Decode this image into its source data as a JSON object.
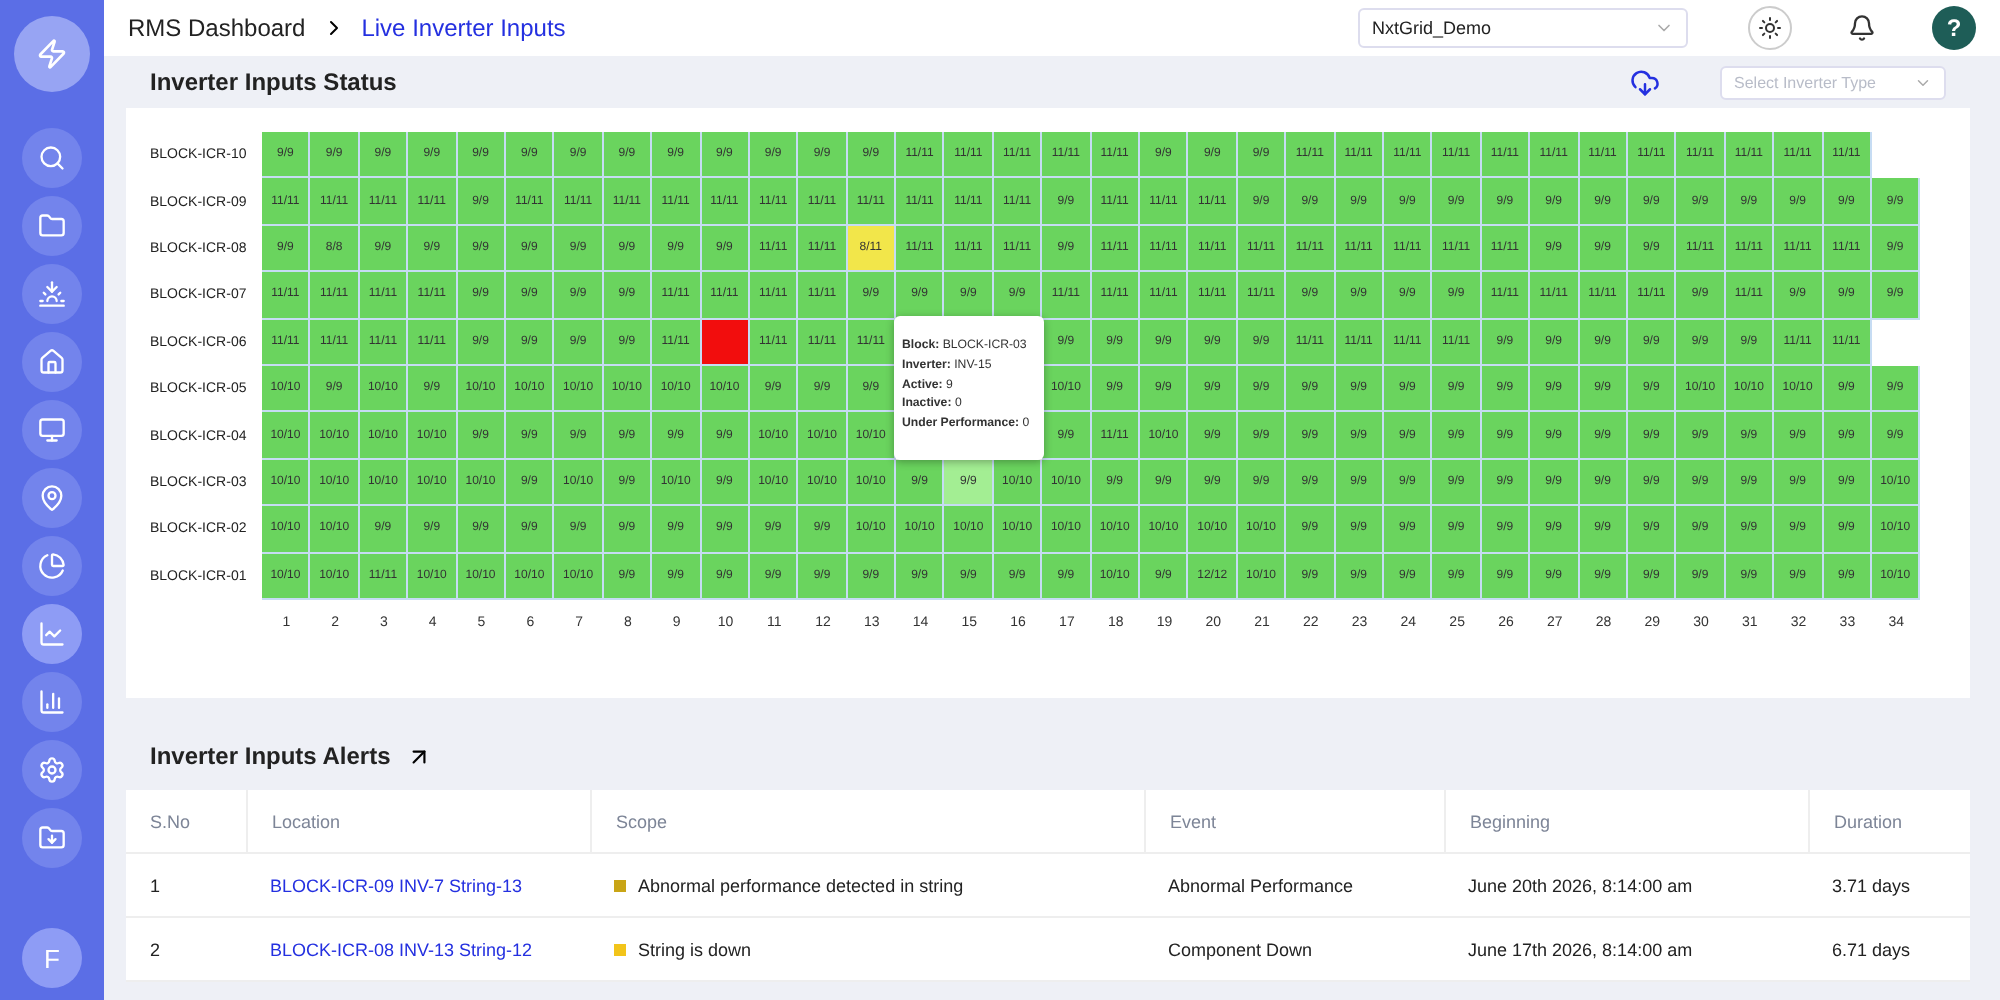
{
  "sidebar": {
    "items": [
      {
        "kind": "search",
        "selected": false
      },
      {
        "kind": "folder",
        "selected": false
      },
      {
        "kind": "sunset",
        "selected": false
      },
      {
        "kind": "home",
        "selected": false
      },
      {
        "kind": "monitor",
        "selected": false
      },
      {
        "kind": "location",
        "selected": false
      },
      {
        "kind": "pie",
        "selected": false
      },
      {
        "kind": "line",
        "selected": true
      },
      {
        "kind": "bar",
        "selected": false
      },
      {
        "kind": "settings",
        "selected": false
      },
      {
        "kind": "download",
        "selected": false
      }
    ],
    "avatar": "F"
  },
  "breadcrumb": [
    "RMS Dashboard",
    "Live Inverter Inputs"
  ],
  "site_select": {
    "value": "NxtGrid_Demo"
  },
  "help": "?",
  "status_panel": {
    "title": "Inverter Inputs Status",
    "type_select": {
      "placeholder": "Select Inverter Type"
    },
    "rows": [
      {
        "label": "BLOCK-ICR-10",
        "cells": [
          {
            "text": "9/9",
            "color": "#6ad45e"
          },
          {
            "text": "9/9",
            "color": "#6ad45e"
          },
          {
            "text": "9/9",
            "color": "#6ad45e"
          },
          {
            "text": "9/9",
            "color": "#6ad45e"
          },
          {
            "text": "9/9",
            "color": "#6ad45e"
          },
          {
            "text": "9/9",
            "color": "#6ad45e"
          },
          {
            "text": "9/9",
            "color": "#6ad45e"
          },
          {
            "text": "9/9",
            "color": "#6ad45e"
          },
          {
            "text": "9/9",
            "color": "#6ad45e"
          },
          {
            "text": "9/9",
            "color": "#6ad45e"
          },
          {
            "text": "9/9",
            "color": "#6ad45e"
          },
          {
            "text": "9/9",
            "color": "#6ad45e"
          },
          {
            "text": "9/9",
            "color": "#6ad45e"
          },
          {
            "text": "11/11",
            "color": "#6ad45e"
          },
          {
            "text": "11/11",
            "color": "#6ad45e"
          },
          {
            "text": "11/11",
            "color": "#6ad45e"
          },
          {
            "text": "11/11",
            "color": "#6ad45e"
          },
          {
            "text": "11/11",
            "color": "#6ad45e"
          },
          {
            "text": "9/9",
            "color": "#6ad45e"
          },
          {
            "text": "9/9",
            "color": "#6ad45e"
          },
          {
            "text": "9/9",
            "color": "#6ad45e"
          },
          {
            "text": "11/11",
            "color": "#6ad45e"
          },
          {
            "text": "11/11",
            "color": "#6ad45e"
          },
          {
            "text": "11/11",
            "color": "#6ad45e"
          },
          {
            "text": "11/11",
            "color": "#6ad45e"
          },
          {
            "text": "11/11",
            "color": "#6ad45e"
          },
          {
            "text": "11/11",
            "color": "#6ad45e"
          },
          {
            "text": "11/11",
            "color": "#6ad45e"
          },
          {
            "text": "11/11",
            "color": "#6ad45e"
          },
          {
            "text": "11/11",
            "color": "#6ad45e"
          },
          {
            "text": "11/11",
            "color": "#6ad45e"
          },
          {
            "text": "11/11",
            "color": "#6ad45e"
          },
          {
            "text": "11/11",
            "color": "#6ad45e"
          }
        ]
      },
      {
        "label": "BLOCK-ICR-09",
        "cells": [
          {
            "text": "11/11",
            "color": "#6ad45e"
          },
          {
            "text": "11/11",
            "color": "#6ad45e"
          },
          {
            "text": "11/11",
            "color": "#6ad45e"
          },
          {
            "text": "11/11",
            "color": "#6ad45e"
          },
          {
            "text": "9/9",
            "color": "#6ad45e"
          },
          {
            "text": "11/11",
            "color": "#6ad45e"
          },
          {
            "text": "11/11",
            "color": "#6ad45e"
          },
          {
            "text": "11/11",
            "color": "#6ad45e"
          },
          {
            "text": "11/11",
            "color": "#6ad45e"
          },
          {
            "text": "11/11",
            "color": "#6ad45e"
          },
          {
            "text": "11/11",
            "color": "#6ad45e"
          },
          {
            "text": "11/11",
            "color": "#6ad45e"
          },
          {
            "text": "11/11",
            "color": "#6ad45e"
          },
          {
            "text": "11/11",
            "color": "#6ad45e"
          },
          {
            "text": "11/11",
            "color": "#6ad45e"
          },
          {
            "text": "11/11",
            "color": "#6ad45e"
          },
          {
            "text": "9/9",
            "color": "#6ad45e"
          },
          {
            "text": "11/11",
            "color": "#6ad45e"
          },
          {
            "text": "11/11",
            "color": "#6ad45e"
          },
          {
            "text": "11/11",
            "color": "#6ad45e"
          },
          {
            "text": "9/9",
            "color": "#6ad45e"
          },
          {
            "text": "9/9",
            "color": "#6ad45e"
          },
          {
            "text": "9/9",
            "color": "#6ad45e"
          },
          {
            "text": "9/9",
            "color": "#6ad45e"
          },
          {
            "text": "9/9",
            "color": "#6ad45e"
          },
          {
            "text": "9/9",
            "color": "#6ad45e"
          },
          {
            "text": "9/9",
            "color": "#6ad45e"
          },
          {
            "text": "9/9",
            "color": "#6ad45e"
          },
          {
            "text": "9/9",
            "color": "#6ad45e"
          },
          {
            "text": "9/9",
            "color": "#6ad45e"
          },
          {
            "text": "9/9",
            "color": "#6ad45e"
          },
          {
            "text": "9/9",
            "color": "#6ad45e"
          },
          {
            "text": "9/9",
            "color": "#6ad45e"
          },
          {
            "text": "9/9",
            "color": "#6ad45e"
          }
        ]
      },
      {
        "label": "BLOCK-ICR-08",
        "cells": [
          {
            "text": "9/9",
            "color": "#6ad45e"
          },
          {
            "text": "8/8",
            "color": "#6ad45e"
          },
          {
            "text": "9/9",
            "color": "#6ad45e"
          },
          {
            "text": "9/9",
            "color": "#6ad45e"
          },
          {
            "text": "9/9",
            "color": "#6ad45e"
          },
          {
            "text": "9/9",
            "color": "#6ad45e"
          },
          {
            "text": "9/9",
            "color": "#6ad45e"
          },
          {
            "text": "9/9",
            "color": "#6ad45e"
          },
          {
            "text": "9/9",
            "color": "#6ad45e"
          },
          {
            "text": "9/9",
            "color": "#6ad45e"
          },
          {
            "text": "11/11",
            "color": "#6ad45e"
          },
          {
            "text": "11/11",
            "color": "#6ad45e"
          },
          {
            "text": "8/11",
            "color": "#f2e64a"
          },
          {
            "text": "11/11",
            "color": "#6ad45e"
          },
          {
            "text": "11/11",
            "color": "#6ad45e"
          },
          {
            "text": "11/11",
            "color": "#6ad45e"
          },
          {
            "text": "9/9",
            "color": "#6ad45e"
          },
          {
            "text": "11/11",
            "color": "#6ad45e"
          },
          {
            "text": "11/11",
            "color": "#6ad45e"
          },
          {
            "text": "11/11",
            "color": "#6ad45e"
          },
          {
            "text": "11/11",
            "color": "#6ad45e"
          },
          {
            "text": "11/11",
            "color": "#6ad45e"
          },
          {
            "text": "11/11",
            "color": "#6ad45e"
          },
          {
            "text": "11/11",
            "color": "#6ad45e"
          },
          {
            "text": "11/11",
            "color": "#6ad45e"
          },
          {
            "text": "11/11",
            "color": "#6ad45e"
          },
          {
            "text": "9/9",
            "color": "#6ad45e"
          },
          {
            "text": "9/9",
            "color": "#6ad45e"
          },
          {
            "text": "9/9",
            "color": "#6ad45e"
          },
          {
            "text": "11/11",
            "color": "#6ad45e"
          },
          {
            "text": "11/11",
            "color": "#6ad45e"
          },
          {
            "text": "11/11",
            "color": "#6ad45e"
          },
          {
            "text": "11/11",
            "color": "#6ad45e"
          },
          {
            "text": "9/9",
            "color": "#6ad45e"
          }
        ]
      },
      {
        "label": "BLOCK-ICR-07",
        "cells": [
          {
            "text": "11/11",
            "color": "#6ad45e"
          },
          {
            "text": "11/11",
            "color": "#6ad45e"
          },
          {
            "text": "11/11",
            "color": "#6ad45e"
          },
          {
            "text": "11/11",
            "color": "#6ad45e"
          },
          {
            "text": "9/9",
            "color": "#6ad45e"
          },
          {
            "text": "9/9",
            "color": "#6ad45e"
          },
          {
            "text": "9/9",
            "color": "#6ad45e"
          },
          {
            "text": "9/9",
            "color": "#6ad45e"
          },
          {
            "text": "11/11",
            "color": "#6ad45e"
          },
          {
            "text": "11/11",
            "color": "#6ad45e"
          },
          {
            "text": "11/11",
            "color": "#6ad45e"
          },
          {
            "text": "11/11",
            "color": "#6ad45e"
          },
          {
            "text": "9/9",
            "color": "#6ad45e"
          },
          {
            "text": "9/9",
            "color": "#6ad45e"
          },
          {
            "text": "9/9",
            "color": "#6ad45e"
          },
          {
            "text": "9/9",
            "color": "#6ad45e"
          },
          {
            "text": "11/11",
            "color": "#6ad45e"
          },
          {
            "text": "11/11",
            "color": "#6ad45e"
          },
          {
            "text": "11/11",
            "color": "#6ad45e"
          },
          {
            "text": "11/11",
            "color": "#6ad45e"
          },
          {
            "text": "11/11",
            "color": "#6ad45e"
          },
          {
            "text": "9/9",
            "color": "#6ad45e"
          },
          {
            "text": "9/9",
            "color": "#6ad45e"
          },
          {
            "text": "9/9",
            "color": "#6ad45e"
          },
          {
            "text": "9/9",
            "color": "#6ad45e"
          },
          {
            "text": "11/11",
            "color": "#6ad45e"
          },
          {
            "text": "11/11",
            "color": "#6ad45e"
          },
          {
            "text": "11/11",
            "color": "#6ad45e"
          },
          {
            "text": "11/11",
            "color": "#6ad45e"
          },
          {
            "text": "9/9",
            "color": "#6ad45e"
          },
          {
            "text": "11/11",
            "color": "#6ad45e"
          },
          {
            "text": "9/9",
            "color": "#6ad45e"
          },
          {
            "text": "9/9",
            "color": "#6ad45e"
          },
          {
            "text": "9/9",
            "color": "#6ad45e"
          }
        ]
      },
      {
        "label": "BLOCK-ICR-06",
        "cells": [
          {
            "text": "11/11",
            "color": "#6ad45e"
          },
          {
            "text": "11/11",
            "color": "#6ad45e"
          },
          {
            "text": "11/11",
            "color": "#6ad45e"
          },
          {
            "text": "11/11",
            "color": "#6ad45e"
          },
          {
            "text": "9/9",
            "color": "#6ad45e"
          },
          {
            "text": "9/9",
            "color": "#6ad45e"
          },
          {
            "text": "9/9",
            "color": "#6ad45e"
          },
          {
            "text": "9/9",
            "color": "#6ad45e"
          },
          {
            "text": "11/11",
            "color": "#6ad45e"
          },
          {
            "color": "#f20d0d"
          },
          {
            "text": "11/11",
            "color": "#6ad45e"
          },
          {
            "text": "11/11",
            "color": "#6ad45e"
          },
          {
            "text": "11/11",
            "color": "#6ad45e"
          },
          null,
          null,
          null,
          {
            "text": "9/9",
            "color": "#6ad45e"
          },
          {
            "text": "9/9",
            "color": "#6ad45e"
          },
          {
            "text": "9/9",
            "color": "#6ad45e"
          },
          {
            "text": "9/9",
            "color": "#6ad45e"
          },
          {
            "text": "9/9",
            "color": "#6ad45e"
          },
          {
            "text": "11/11",
            "color": "#6ad45e"
          },
          {
            "text": "11/11",
            "color": "#6ad45e"
          },
          {
            "text": "11/11",
            "color": "#6ad45e"
          },
          {
            "text": "11/11",
            "color": "#6ad45e"
          },
          {
            "text": "9/9",
            "color": "#6ad45e"
          },
          {
            "text": "9/9",
            "color": "#6ad45e"
          },
          {
            "text": "9/9",
            "color": "#6ad45e"
          },
          {
            "text": "9/9",
            "color": "#6ad45e"
          },
          {
            "text": "9/9",
            "color": "#6ad45e"
          },
          {
            "text": "9/9",
            "color": "#6ad45e"
          },
          {
            "text": "11/11",
            "color": "#6ad45e"
          },
          {
            "text": "11/11",
            "color": "#6ad45e"
          }
        ]
      },
      {
        "label": "BLOCK-ICR-05",
        "cells": [
          {
            "text": "10/10",
            "color": "#6ad45e"
          },
          {
            "text": "9/9",
            "color": "#6ad45e"
          },
          {
            "text": "10/10",
            "color": "#6ad45e"
          },
          {
            "text": "9/9",
            "color": "#6ad45e"
          },
          {
            "text": "10/10",
            "color": "#6ad45e"
          },
          {
            "text": "10/10",
            "color": "#6ad45e"
          },
          {
            "text": "10/10",
            "color": "#6ad45e"
          },
          {
            "text": "10/10",
            "color": "#6ad45e"
          },
          {
            "text": "10/10",
            "color": "#6ad45e"
          },
          {
            "text": "10/10",
            "color": "#6ad45e"
          },
          {
            "text": "9/9",
            "color": "#6ad45e"
          },
          {
            "text": "9/9",
            "color": "#6ad45e"
          },
          {
            "text": "9/9",
            "color": "#6ad45e"
          },
          null,
          null,
          null,
          {
            "text": "10/10",
            "color": "#6ad45e"
          },
          {
            "text": "9/9",
            "color": "#6ad45e"
          },
          {
            "text": "9/9",
            "color": "#6ad45e"
          },
          {
            "text": "9/9",
            "color": "#6ad45e"
          },
          {
            "text": "9/9",
            "color": "#6ad45e"
          },
          {
            "text": "9/9",
            "color": "#6ad45e"
          },
          {
            "text": "9/9",
            "color": "#6ad45e"
          },
          {
            "text": "9/9",
            "color": "#6ad45e"
          },
          {
            "text": "9/9",
            "color": "#6ad45e"
          },
          {
            "text": "9/9",
            "color": "#6ad45e"
          },
          {
            "text": "9/9",
            "color": "#6ad45e"
          },
          {
            "text": "9/9",
            "color": "#6ad45e"
          },
          {
            "text": "9/9",
            "color": "#6ad45e"
          },
          {
            "text": "10/10",
            "color": "#6ad45e"
          },
          {
            "text": "10/10",
            "color": "#6ad45e"
          },
          {
            "text": "10/10",
            "color": "#6ad45e"
          },
          {
            "text": "9/9",
            "color": "#6ad45e"
          },
          {
            "text": "9/9",
            "color": "#6ad45e"
          }
        ]
      },
      {
        "label": "BLOCK-ICR-04",
        "cells": [
          {
            "text": "10/10",
            "color": "#6ad45e"
          },
          {
            "text": "10/10",
            "color": "#6ad45e"
          },
          {
            "text": "10/10",
            "color": "#6ad45e"
          },
          {
            "text": "10/10",
            "color": "#6ad45e"
          },
          {
            "text": "9/9",
            "color": "#6ad45e"
          },
          {
            "text": "9/9",
            "color": "#6ad45e"
          },
          {
            "text": "9/9",
            "color": "#6ad45e"
          },
          {
            "text": "9/9",
            "color": "#6ad45e"
          },
          {
            "text": "9/9",
            "color": "#6ad45e"
          },
          {
            "text": "9/9",
            "color": "#6ad45e"
          },
          {
            "text": "10/10",
            "color": "#6ad45e"
          },
          {
            "text": "10/10",
            "color": "#6ad45e"
          },
          {
            "text": "10/10",
            "color": "#6ad45e"
          },
          null,
          null,
          null,
          {
            "text": "9/9",
            "color": "#6ad45e"
          },
          {
            "text": "11/11",
            "color": "#6ad45e"
          },
          {
            "text": "10/10",
            "color": "#6ad45e"
          },
          {
            "text": "9/9",
            "color": "#6ad45e"
          },
          {
            "text": "9/9",
            "color": "#6ad45e"
          },
          {
            "text": "9/9",
            "color": "#6ad45e"
          },
          {
            "text": "9/9",
            "color": "#6ad45e"
          },
          {
            "text": "9/9",
            "color": "#6ad45e"
          },
          {
            "text": "9/9",
            "color": "#6ad45e"
          },
          {
            "text": "9/9",
            "color": "#6ad45e"
          },
          {
            "text": "9/9",
            "color": "#6ad45e"
          },
          {
            "text": "9/9",
            "color": "#6ad45e"
          },
          {
            "text": "9/9",
            "color": "#6ad45e"
          },
          {
            "text": "9/9",
            "color": "#6ad45e"
          },
          {
            "text": "9/9",
            "color": "#6ad45e"
          },
          {
            "text": "9/9",
            "color": "#6ad45e"
          },
          {
            "text": "9/9",
            "color": "#6ad45e"
          },
          {
            "text": "9/9",
            "color": "#6ad45e"
          }
        ]
      },
      {
        "label": "BLOCK-ICR-03",
        "cells": [
          {
            "text": "10/10",
            "color": "#6ad45e"
          },
          {
            "text": "10/10",
            "color": "#6ad45e"
          },
          {
            "text": "10/10",
            "color": "#6ad45e"
          },
          {
            "text": "10/10",
            "color": "#6ad45e"
          },
          {
            "text": "10/10",
            "color": "#6ad45e"
          },
          {
            "text": "9/9",
            "color": "#6ad45e"
          },
          {
            "text": "10/10",
            "color": "#6ad45e"
          },
          {
            "text": "9/9",
            "color": "#6ad45e"
          },
          {
            "text": "10/10",
            "color": "#6ad45e"
          },
          {
            "text": "9/9",
            "color": "#6ad45e"
          },
          {
            "text": "10/10",
            "color": "#6ad45e"
          },
          {
            "text": "10/10",
            "color": "#6ad45e"
          },
          {
            "text": "10/10",
            "color": "#6ad45e"
          },
          {
            "text": "9/9",
            "color": "#6ad45e"
          },
          {
            "text": "9/9",
            "color": "#a3ee93"
          },
          {
            "text": "10/10",
            "color": "#6ad45e"
          },
          {
            "text": "10/10",
            "color": "#6ad45e"
          },
          {
            "text": "9/9",
            "color": "#6ad45e"
          },
          {
            "text": "9/9",
            "color": "#6ad45e"
          },
          {
            "text": "9/9",
            "color": "#6ad45e"
          },
          {
            "text": "9/9",
            "color": "#6ad45e"
          },
          {
            "text": "9/9",
            "color": "#6ad45e"
          },
          {
            "text": "9/9",
            "color": "#6ad45e"
          },
          {
            "text": "9/9",
            "color": "#6ad45e"
          },
          {
            "text": "9/9",
            "color": "#6ad45e"
          },
          {
            "text": "9/9",
            "color": "#6ad45e"
          },
          {
            "text": "9/9",
            "color": "#6ad45e"
          },
          {
            "text": "9/9",
            "color": "#6ad45e"
          },
          {
            "text": "9/9",
            "color": "#6ad45e"
          },
          {
            "text": "9/9",
            "color": "#6ad45e"
          },
          {
            "text": "9/9",
            "color": "#6ad45e"
          },
          {
            "text": "9/9",
            "color": "#6ad45e"
          },
          {
            "text": "9/9",
            "color": "#6ad45e"
          },
          {
            "text": "10/10",
            "color": "#6ad45e"
          }
        ]
      },
      {
        "label": "BLOCK-ICR-02",
        "cells": [
          {
            "text": "10/10",
            "color": "#6ad45e"
          },
          {
            "text": "10/10",
            "color": "#6ad45e"
          },
          {
            "text": "9/9",
            "color": "#6ad45e"
          },
          {
            "text": "9/9",
            "color": "#6ad45e"
          },
          {
            "text": "9/9",
            "color": "#6ad45e"
          },
          {
            "text": "9/9",
            "color": "#6ad45e"
          },
          {
            "text": "9/9",
            "color": "#6ad45e"
          },
          {
            "text": "9/9",
            "color": "#6ad45e"
          },
          {
            "text": "9/9",
            "color": "#6ad45e"
          },
          {
            "text": "9/9",
            "color": "#6ad45e"
          },
          {
            "text": "9/9",
            "color": "#6ad45e"
          },
          {
            "text": "9/9",
            "color": "#6ad45e"
          },
          {
            "text": "10/10",
            "color": "#6ad45e"
          },
          {
            "text": "10/10",
            "color": "#6ad45e"
          },
          {
            "text": "10/10",
            "color": "#6ad45e"
          },
          {
            "text": "10/10",
            "color": "#6ad45e"
          },
          {
            "text": "10/10",
            "color": "#6ad45e"
          },
          {
            "text": "10/10",
            "color": "#6ad45e"
          },
          {
            "text": "10/10",
            "color": "#6ad45e"
          },
          {
            "text": "10/10",
            "color": "#6ad45e"
          },
          {
            "text": "10/10",
            "color": "#6ad45e"
          },
          {
            "text": "9/9",
            "color": "#6ad45e"
          },
          {
            "text": "9/9",
            "color": "#6ad45e"
          },
          {
            "text": "9/9",
            "color": "#6ad45e"
          },
          {
            "text": "9/9",
            "color": "#6ad45e"
          },
          {
            "text": "9/9",
            "color": "#6ad45e"
          },
          {
            "text": "9/9",
            "color": "#6ad45e"
          },
          {
            "text": "9/9",
            "color": "#6ad45e"
          },
          {
            "text": "9/9",
            "color": "#6ad45e"
          },
          {
            "text": "9/9",
            "color": "#6ad45e"
          },
          {
            "text": "9/9",
            "color": "#6ad45e"
          },
          {
            "text": "9/9",
            "color": "#6ad45e"
          },
          {
            "text": "9/9",
            "color": "#6ad45e"
          },
          {
            "text": "10/10",
            "color": "#6ad45e"
          }
        ]
      },
      {
        "label": "BLOCK-ICR-01",
        "cells": [
          {
            "text": "10/10",
            "color": "#6ad45e"
          },
          {
            "text": "10/10",
            "color": "#6ad45e"
          },
          {
            "text": "11/11",
            "color": "#6ad45e"
          },
          {
            "text": "10/10",
            "color": "#6ad45e"
          },
          {
            "text": "10/10",
            "color": "#6ad45e"
          },
          {
            "text": "10/10",
            "color": "#6ad45e"
          },
          {
            "text": "10/10",
            "color": "#6ad45e"
          },
          {
            "text": "9/9",
            "color": "#6ad45e"
          },
          {
            "text": "9/9",
            "color": "#6ad45e"
          },
          {
            "text": "9/9",
            "color": "#6ad45e"
          },
          {
            "text": "9/9",
            "color": "#6ad45e"
          },
          {
            "text": "9/9",
            "color": "#6ad45e"
          },
          {
            "text": "9/9",
            "color": "#6ad45e"
          },
          {
            "text": "9/9",
            "color": "#6ad45e"
          },
          {
            "text": "9/9",
            "color": "#6ad45e"
          },
          {
            "text": "9/9",
            "color": "#6ad45e"
          },
          {
            "text": "9/9",
            "color": "#6ad45e"
          },
          {
            "text": "10/10",
            "color": "#6ad45e"
          },
          {
            "text": "9/9",
            "color": "#6ad45e"
          },
          {
            "text": "12/12",
            "color": "#6ad45e"
          },
          {
            "text": "10/10",
            "color": "#6ad45e"
          },
          {
            "text": "9/9",
            "color": "#6ad45e"
          },
          {
            "text": "9/9",
            "color": "#6ad45e"
          },
          {
            "text": "9/9",
            "color": "#6ad45e"
          },
          {
            "text": "9/9",
            "color": "#6ad45e"
          },
          {
            "text": "9/9",
            "color": "#6ad45e"
          },
          {
            "text": "9/9",
            "color": "#6ad45e"
          },
          {
            "text": "9/9",
            "color": "#6ad45e"
          },
          {
            "text": "9/9",
            "color": "#6ad45e"
          },
          {
            "text": "9/9",
            "color": "#6ad45e"
          },
          {
            "text": "9/9",
            "color": "#6ad45e"
          },
          {
            "text": "9/9",
            "color": "#6ad45e"
          },
          {
            "text": "9/9",
            "color": "#6ad45e"
          },
          {
            "text": "10/10",
            "color": "#6ad45e"
          }
        ]
      }
    ],
    "x_axis_labels": [
      "1",
      "2",
      "3",
      "4",
      "5",
      "6",
      "7",
      "8",
      "9",
      "10",
      "11",
      "12",
      "13",
      "14",
      "15",
      "16",
      "17",
      "18",
      "19",
      "20",
      "21",
      "22",
      "23",
      "24",
      "25",
      "26",
      "27",
      "28",
      "29",
      "30",
      "31",
      "32",
      "33",
      "34"
    ],
    "tooltip": {
      "lines": [
        {
          "label": "Block:",
          "value": "BLOCK-ICR-03"
        },
        {
          "label": "Inverter:",
          "value": "INV-15"
        },
        {
          "label": "Active:",
          "value": "9"
        },
        {
          "label": "Inactive:",
          "value": "0"
        },
        {
          "label": "Under Performance:",
          "value": "0"
        }
      ]
    }
  },
  "alerts": {
    "title": "Inverter Inputs Alerts",
    "columns": [
      "S.No",
      "Location",
      "Scope",
      "Event",
      "Beginning",
      "Duration"
    ],
    "rows": [
      {
        "sno": "1",
        "location": "BLOCK-ICR-09 INV-7 String-13",
        "scope": "Abnormal performance detected in string",
        "color": "#c9a516",
        "event": "Abnormal Performance",
        "beginning": "June 20th 2026, 8:14:00 am",
        "duration": "3.71 days"
      },
      {
        "sno": "2",
        "location": "BLOCK-ICR-08 INV-13 String-12",
        "scope": "String is down",
        "color": "#f2c41a",
        "event": "Component Down",
        "beginning": "June 17th 2026, 8:14:00 am",
        "duration": "6.71 days"
      }
    ]
  }
}
